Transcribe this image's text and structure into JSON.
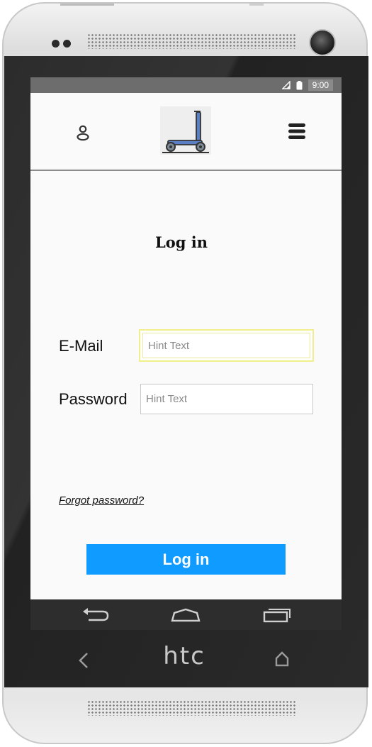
{
  "device": {
    "brand": "htc"
  },
  "status_bar": {
    "time": "9:00",
    "icons": [
      "signal-icon",
      "battery-icon"
    ]
  },
  "header": {
    "left_icon": "user-icon",
    "logo": "kick-scooter-icon",
    "right_icon": "hamburger-menu-icon"
  },
  "login": {
    "title": "Log in",
    "email_label": "E-Mail",
    "email_placeholder": "Hint Text",
    "email_value": "",
    "password_label": "Password",
    "password_placeholder": "Hint Text",
    "password_value": "",
    "forgot_password": "Forgot password?",
    "submit_label": "Log in"
  },
  "nav_bar": {
    "buttons": [
      "back-icon",
      "home-icon",
      "recent-apps-icon"
    ]
  },
  "colors": {
    "accent": "#0f9bff",
    "focus_outline": "#f1ee8c",
    "status_bar": "#6d6d6d"
  }
}
